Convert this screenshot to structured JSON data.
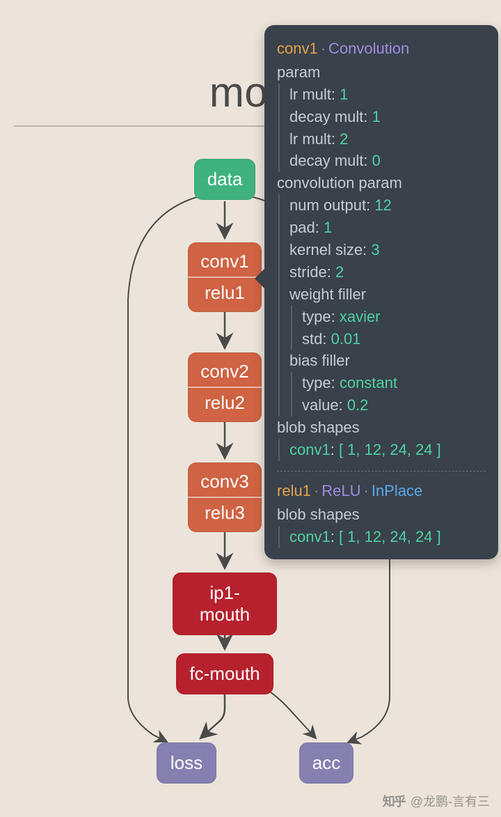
{
  "title": "mou",
  "nodes": {
    "data": {
      "label": "data"
    },
    "conv1": {
      "top": "conv1",
      "bot": "relu1"
    },
    "conv2": {
      "top": "conv2",
      "bot": "relu2"
    },
    "conv3": {
      "top": "conv3",
      "bot": "relu3"
    },
    "ip1": {
      "label": "ip1-mouth"
    },
    "fc": {
      "label": "fc-mouth"
    },
    "loss": {
      "label": "loss"
    },
    "acc": {
      "label": "acc"
    }
  },
  "panel": {
    "layer1": {
      "name": "conv1",
      "type": "Convolution",
      "section_param": "param",
      "params": [
        {
          "k": "lr mult",
          "v": "1"
        },
        {
          "k": "decay mult",
          "v": "1"
        },
        {
          "k": "lr mult",
          "v": "2"
        },
        {
          "k": "decay mult",
          "v": "0"
        }
      ],
      "section_conv": "convolution param",
      "conv_params": [
        {
          "k": "num output",
          "v": "12"
        },
        {
          "k": "pad",
          "v": "1"
        },
        {
          "k": "kernel size",
          "v": "3"
        },
        {
          "k": "stride",
          "v": "2"
        }
      ],
      "weight_filler_label": "weight filler",
      "weight_filler": [
        {
          "k": "type",
          "v": "xavier"
        },
        {
          "k": "std",
          "v": "0.01"
        }
      ],
      "bias_filler_label": "bias filler",
      "bias_filler": [
        {
          "k": "type",
          "v": "constant"
        },
        {
          "k": "value",
          "v": "0.2"
        }
      ],
      "blob_label": "blob shapes",
      "blob_name": "conv1",
      "blob_shape": "[ 1, 12, 24, 24 ]"
    },
    "layer2": {
      "name": "relu1",
      "type": "ReLU",
      "extra": "InPlace",
      "blob_label": "blob shapes",
      "blob_name": "conv1",
      "blob_shape": "[ 1, 12, 24, 24 ]"
    }
  },
  "watermark": "@龙鹏-言有三",
  "watermark_prefix": "知乎"
}
